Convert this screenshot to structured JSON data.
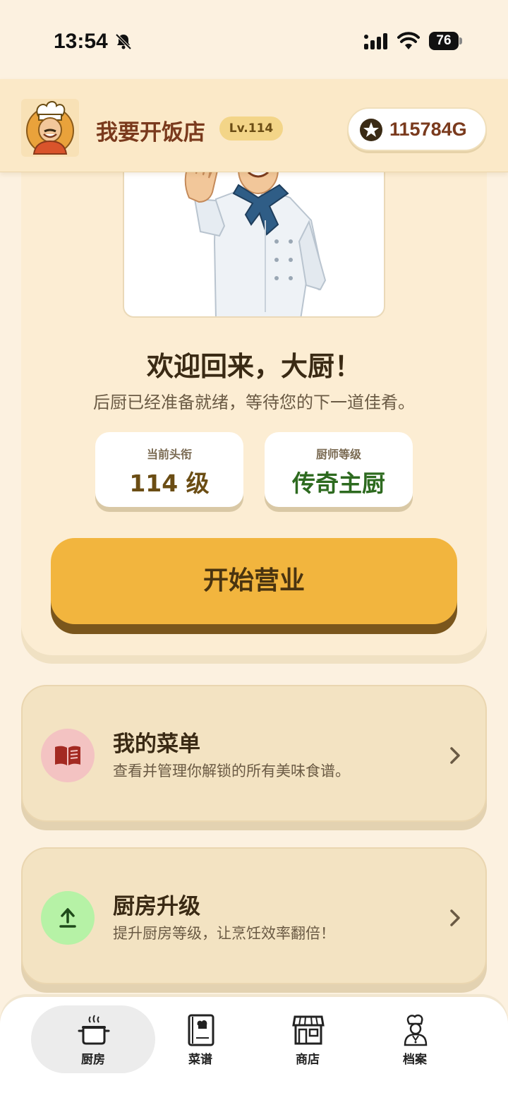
{
  "status_bar": {
    "time": "13:54",
    "battery": "76"
  },
  "header": {
    "app_title": "我要开饭店",
    "level": "Lv.114",
    "coins": "115784G"
  },
  "welcome": {
    "title": "欢迎回来，大厨！",
    "subtitle": "后厨已经准备就绪，等待您的下一道佳肴。",
    "stats": [
      {
        "label": "当前头衔",
        "value": "114 级"
      },
      {
        "label": "厨师等级",
        "value": "传奇主厨"
      }
    ],
    "start_button": "开始营业"
  },
  "features": [
    {
      "title": "我的菜单",
      "description": "查看并管理你解锁的所有美味食谱。",
      "icon": "recipe-book-icon"
    },
    {
      "title": "厨房升级",
      "description": "提升厨房等级，让烹饪效率翻倍！",
      "icon": "upload-arrow-icon"
    }
  ],
  "bottom_nav": {
    "items": [
      {
        "label": "厨房",
        "icon": "cooking-pot-icon",
        "active": true
      },
      {
        "label": "菜谱",
        "icon": "cookbook-icon",
        "active": false
      },
      {
        "label": "商店",
        "icon": "store-icon",
        "active": false
      },
      {
        "label": "档案",
        "icon": "chef-profile-icon",
        "active": false
      }
    ]
  },
  "colors": {
    "background": "#fcf1e0",
    "header": "#fbe9c8",
    "accent_button": "#f2b53e",
    "title_brown": "#7a3a1d",
    "green_text": "#2d6a1f"
  }
}
